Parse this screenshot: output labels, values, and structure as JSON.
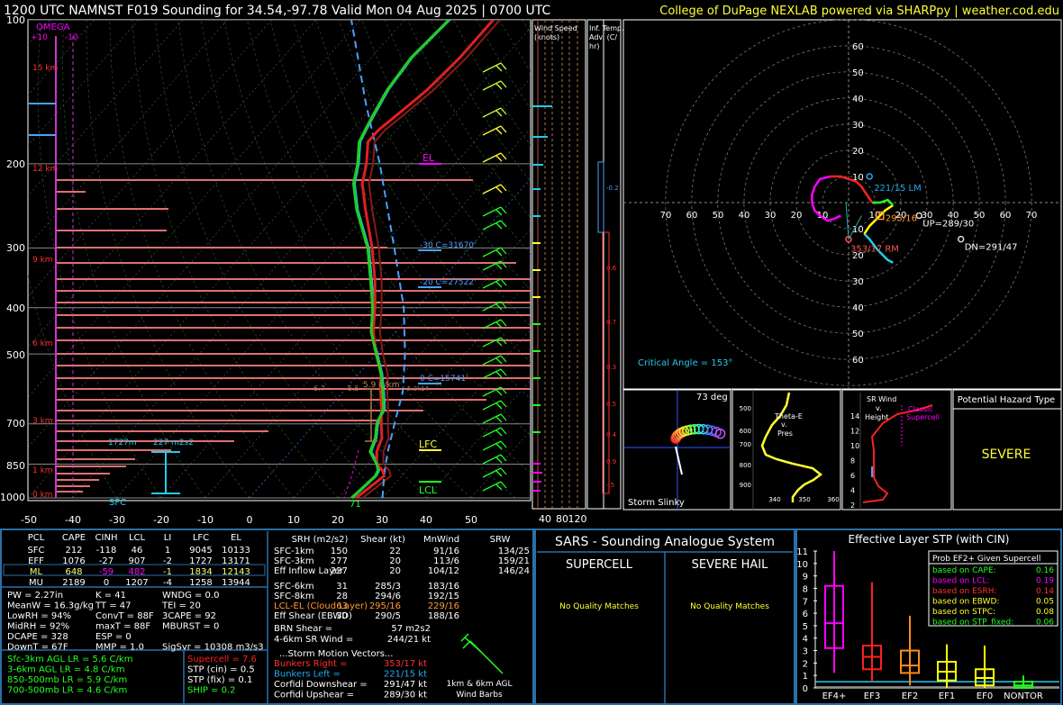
{
  "header": {
    "title": "1200 UTC NAMNST F019 Sounding for 34.54,-97.78 Valid  Mon 04 Aug 2025 | 0700 UTC",
    "credit": "College of DuPage NEXLAB powered via SHARPpy | weather.cod.edu"
  },
  "colors": {
    "temp": "#e02020",
    "dew": "#22cc22",
    "wetbulb": "#22ccee",
    "parcel": "#4aa0ff",
    "hodo_red": "#ff2020",
    "magenta": "#ff00ff",
    "yellow": "#ffff33"
  },
  "chart_data": [
    {
      "type": "line",
      "title": "",
      "xlabel": "",
      "ylabel": "",
      "x_ticks": [
        "-50",
        "-40",
        "-30",
        "-20",
        "-10",
        "0",
        "10",
        "20",
        "30",
        "40",
        "50"
      ],
      "p_ticks": [
        "100",
        "200",
        "300",
        "400",
        "500",
        "700",
        "850",
        "1000"
      ],
      "height_labels": [
        "15 km",
        "12 km",
        "9 km",
        "6 km",
        "3 km",
        "1 km",
        "0 km"
      ],
      "omega_labels": {
        "title": "OMEGA",
        "left": "+10",
        "right": "-10"
      },
      "series": [
        {
          "kind": "temperature",
          "points": [
            [
              1000,
              24
            ],
            [
              950,
              25
            ],
            [
              900,
              26
            ],
            [
              875,
              24.5
            ],
            [
              850,
              22
            ],
            [
              800,
              19.5
            ],
            [
              750,
              18
            ],
            [
              700,
              15
            ],
            [
              650,
              12
            ],
            [
              600,
              8.5
            ],
            [
              550,
              5
            ],
            [
              500,
              0
            ],
            [
              450,
              -5
            ],
            [
              400,
              -9.5
            ],
            [
              350,
              -15
            ],
            [
              300,
              -22
            ],
            [
              250,
              -31
            ],
            [
              220,
              -37
            ],
            [
              200,
              -40
            ],
            [
              180,
              -44
            ],
            [
              170,
              -44
            ],
            [
              160,
              -43
            ],
            [
              150,
              -42
            ],
            [
              140,
              -41
            ],
            [
              120,
              -40
            ],
            [
              100,
              -40
            ]
          ]
        },
        {
          "kind": "dewpoint",
          "points": [
            [
              1000,
              23
            ],
            [
              950,
              23.5
            ],
            [
              900,
              24
            ],
            [
              875,
              23.5
            ],
            [
              850,
              22
            ],
            [
              800,
              18
            ],
            [
              750,
              16.5
            ],
            [
              700,
              14
            ],
            [
              650,
              12.5
            ],
            [
              600,
              9
            ],
            [
              550,
              5
            ],
            [
              500,
              0
            ],
            [
              450,
              -5.5
            ],
            [
              400,
              -10
            ],
            [
              350,
              -16
            ],
            [
              300,
              -23
            ],
            [
              250,
              -33
            ],
            [
              220,
              -39
            ],
            [
              200,
              -42
            ],
            [
              180,
              -46
            ],
            [
              170,
              -47
            ],
            [
              160,
              -48
            ],
            [
              140,
              -50
            ],
            [
              120,
              -51
            ],
            [
              100,
              -50
            ]
          ]
        }
      ],
      "annotations": {
        "el": "EL",
        "lfc": "LFC",
        "lcl": "LCL",
        "sfc": "SFC",
        "m30": "-30 C=31670'",
        "m20": "-20 C=27522'",
        "zero": "0 C=15741'",
        "lr_small_1": "6.7",
        "lr_small_2": "5.5",
        "lr_label": "5.9 C/km",
        "lr_small_3": "5.3k14",
        "eff_left": "1727m",
        "eff_mid": "227 m2s2",
        "sfc_temp": "71"
      }
    },
    {
      "type": "line",
      "title": "",
      "rings": [
        "10",
        "20",
        "30",
        "40",
        "50",
        "60"
      ],
      "x_ticks": [
        "70",
        "60",
        "50",
        "40",
        "30",
        "20",
        "10",
        "10",
        "20",
        "30",
        "40",
        "50",
        "60",
        "70"
      ],
      "series": [
        {
          "name": "hodograph",
          "points": [
            [
              18,
              10
            ],
            [
              16,
              12
            ],
            [
              13,
              14
            ],
            [
              10,
              15
            ],
            [
              6,
              15
            ],
            [
              2,
              14
            ],
            [
              -2,
              12
            ],
            [
              -5,
              9
            ],
            [
              -8,
              7
            ],
            [
              -12,
              7
            ],
            [
              -17,
              5
            ],
            [
              -18,
              2
            ],
            [
              -18,
              -2
            ],
            [
              -16,
              -6
            ],
            [
              -13,
              -9
            ],
            [
              -8,
              -10
            ],
            [
              -5,
              -10
            ],
            [
              -1,
              -10
            ],
            [
              2,
              -12
            ],
            [
              5,
              -13
            ],
            [
              10,
              -13
            ],
            [
              14,
              -13
            ],
            [
              18,
              -14
            ],
            [
              21,
              -12
            ],
            [
              23,
              -10
            ],
            [
              24,
              -7
            ],
            [
              24,
              -3
            ],
            [
              23,
              1
            ],
            [
              22,
              4
            ],
            [
              21,
              7
            ],
            [
              20,
              8
            ],
            [
              18,
              10
            ]
          ]
        }
      ],
      "labels": {
        "lm": "221/15 LM",
        "rm": "353/17 RM",
        "mean": "295/16",
        "up": "UP=289/30",
        "dn": "DN=291/47",
        "critical": "Critical Angle = 153°"
      }
    }
  ],
  "wind_panel": {
    "title_1": "Wind Speed",
    "title_2": "(knots)",
    "ticks": [
      "40",
      "80",
      "120"
    ]
  },
  "temp_adv": {
    "title_1": "Inf. Temp.",
    "title_2": "Adv. (C/",
    "title_3": "hr)",
    "values": [
      "-0.2",
      "0.6",
      "0.7",
      "0.3",
      "0.5",
      "0.4",
      "0.9",
      "-.5"
    ]
  },
  "slinky": {
    "title": "Storm Slinky",
    "deg": "73 deg"
  },
  "theta_e": {
    "title_1": "Theta-E",
    "title_2": "v.",
    "title_3": "Pres",
    "p_ticks": [
      "500",
      "600",
      "700",
      "800",
      "900"
    ],
    "x_ticks": [
      "340",
      "350",
      "360"
    ]
  },
  "srwind": {
    "title_1": "SR Wind",
    "title_2": "v.",
    "title_3": "Height",
    "classic_1": "Classic",
    "classic_2": "Supercell",
    "h_ticks": [
      "14",
      "12",
      "10",
      "8",
      "6",
      "4",
      "2"
    ]
  },
  "hazard": {
    "title": "Potential Hazard Type",
    "value": "SEVERE"
  },
  "parcel_table": {
    "headers": [
      "PCL",
      "CAPE",
      "CINH",
      "LCL",
      "LI",
      "LFC",
      "EL"
    ],
    "rows": [
      [
        "SFC",
        "212",
        "-118",
        "46",
        "1",
        "9045",
        "10133"
      ],
      [
        "EFF",
        "1076",
        "-27",
        "907",
        "-2",
        "1727",
        "13171"
      ],
      [
        "ML",
        "648",
        "-59",
        "482",
        "-1",
        "1834",
        "12143"
      ],
      [
        "MU",
        "2189",
        "0",
        "1207",
        "-4",
        "1258",
        "13944"
      ]
    ],
    "indices": [
      [
        "PW = 2.27in",
        "K = 41",
        "WNDG = 0.0"
      ],
      [
        "MeanW = 16.3g/kg",
        "TT = 47",
        "TEI = 20"
      ],
      [
        "LowRH = 94%",
        "ConvT = 88F",
        "3CAPE = 92"
      ],
      [
        "MidRH = 92%",
        "maxT = 88F",
        "MBURST = 0"
      ],
      [
        "DCAPE = 328",
        "ESP = 0",
        ""
      ],
      [
        "DownT = 67F",
        "MMP = 1.0",
        "SigSvr = 10308 m3/s3"
      ]
    ],
    "lapse": [
      "Sfc-3km AGL LR = 5.6 C/km",
      "3-6km AGL LR = 4.8 C/km",
      "850-500mb LR = 5.9 C/km",
      "700-500mb LR = 4.6 C/km"
    ],
    "params": [
      "Supercell = 7.6",
      "STP (cin) = 0.5",
      "STP (fix) = 0.1",
      "SHIP = 0.2"
    ]
  },
  "kinematics": {
    "headers": [
      "SRH (m2/s2)",
      "Shear (kt)",
      "MnWind",
      "SRW"
    ],
    "rows": [
      [
        "SFC-1km",
        "150",
        "22",
        "91/16",
        "134/25"
      ],
      [
        "SFC-3km",
        "277",
        "20",
        "113/6",
        "159/21"
      ],
      [
        "Eff Inflow Layer",
        "227",
        "20",
        "104/12",
        "146/24"
      ],
      [
        "SFC-6km",
        "31",
        "285/3",
        "183/16",
        ""
      ],
      [
        "SFC-8km",
        "28",
        "294/6",
        "192/15",
        ""
      ],
      [
        "LCL-EL (Cloud Layer)",
        "63",
        "295/16",
        "229/16",
        ""
      ],
      [
        "Eff Shear (EBWD)",
        "30",
        "290/5",
        "188/16",
        ""
      ]
    ],
    "brn": "BRN Shear =",
    "brn_val": "57 m2s2",
    "sr46": "4-6km SR Wind =",
    "sr46_val": "244/21 kt",
    "sm_title": "...Storm Motion Vectors...",
    "sm": [
      [
        "Bunkers Right =",
        "353/17 kt"
      ],
      [
        "Bunkers Left =",
        "221/15 kt"
      ],
      [
        "Corfidi Downshear =",
        "291/47 kt"
      ],
      [
        "Corfidi Upshear =",
        "289/30 kt"
      ]
    ],
    "barbs_1": "1km & 6km AGL",
    "barbs_2": "Wind Barbs"
  },
  "sars": {
    "title": "SARS - Sounding Analogue System",
    "supercell": "SUPERCELL",
    "hail": "SEVERE HAIL",
    "nq1": "No Quality Matches",
    "nq2": "No Quality Matches"
  },
  "stp": {
    "title": "Effective Layer STP (with CIN)",
    "y_ticks": [
      "11",
      "10",
      "9",
      "8",
      "7",
      "6",
      "5",
      "4",
      "3",
      "2",
      "1",
      "0"
    ],
    "categories": [
      "EF4+",
      "EF3",
      "EF2",
      "EF1",
      "EF0",
      "NONTOR"
    ],
    "box_colors": [
      "#ff00ff",
      "#ff2020",
      "#ff8c1a",
      "#ffff00",
      "#ffff00",
      "#22ff22"
    ],
    "boxes": [
      [
        1.2,
        3.2,
        5.2,
        8.2,
        11
      ],
      [
        0.5,
        1.5,
        2.5,
        3.4,
        8.5
      ],
      [
        0.2,
        1.2,
        1.8,
        3.0,
        5.8
      ],
      [
        0,
        0.6,
        1.3,
        2.1,
        3.5
      ],
      [
        0,
        0.2,
        0.8,
        1.5,
        3.4
      ],
      [
        0,
        0,
        0.2,
        0.5,
        1.0
      ]
    ],
    "box_title": "Prob EF2+ Given Supercell",
    "probs": [
      [
        "based on CAPE:",
        "0.16"
      ],
      [
        "based on LCL:",
        "0.19"
      ],
      [
        "based on ESRH:",
        "0.14"
      ],
      [
        "based on EBWD:",
        "0.05"
      ],
      [
        "based on STPC:",
        "0.08"
      ],
      [
        "based on STP_fixed:",
        "0.06"
      ]
    ]
  }
}
